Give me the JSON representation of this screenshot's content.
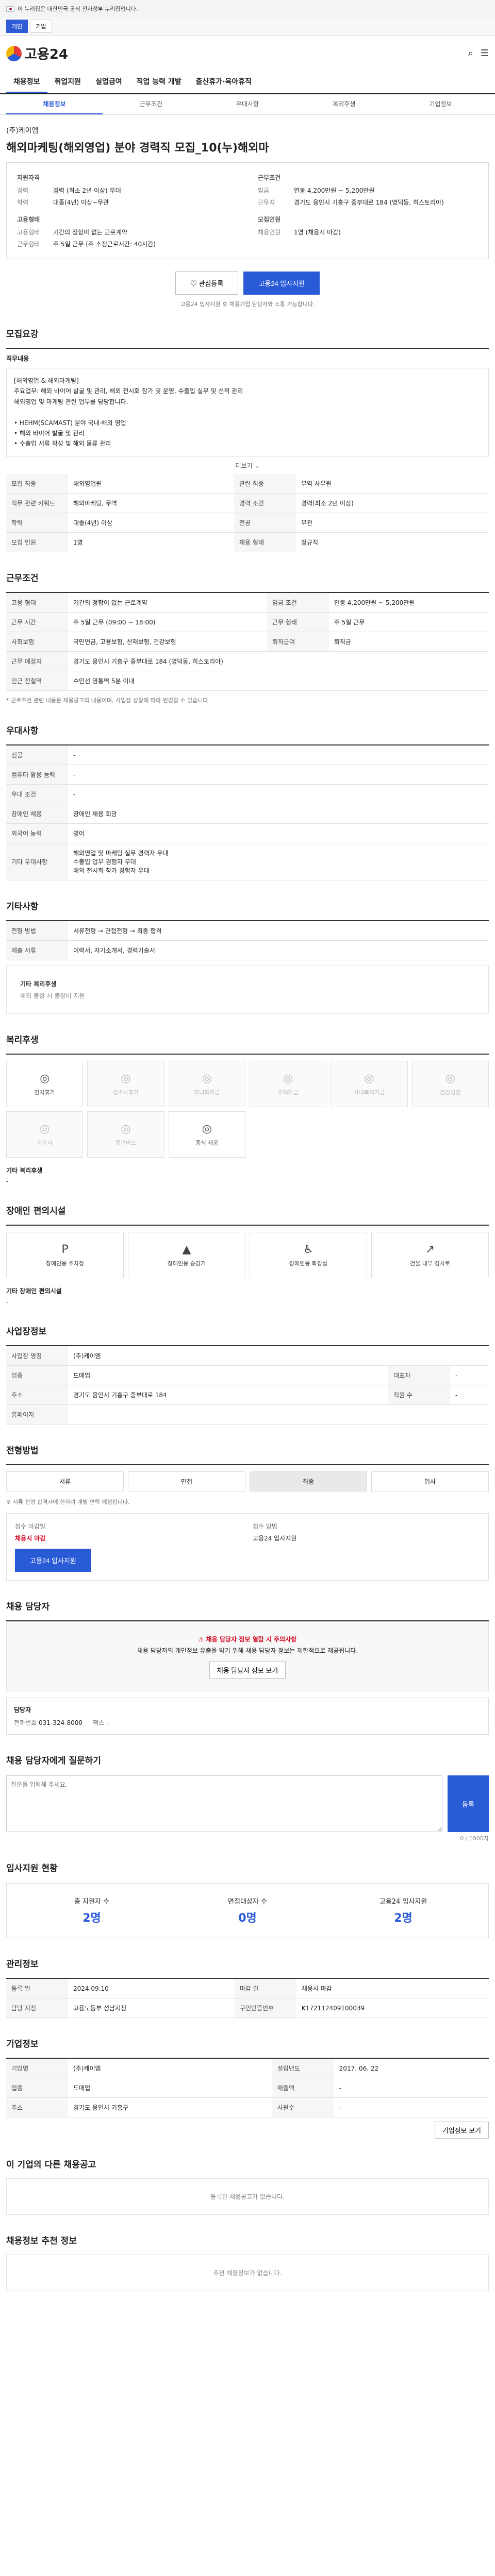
{
  "gov_notice": "이 누리집은 대한민국 공식 전자정부 누리집입니다.",
  "top_tabs": [
    "개인",
    "기업"
  ],
  "logo": "고용24",
  "nav": [
    "채용정보",
    "취업지원",
    "실업급여",
    "직업 능력 개발",
    "출산휴가·육아휴직"
  ],
  "subnav": [
    "채용정보",
    "근무조건",
    "우대사항",
    "복리후생",
    "기업정보"
  ],
  "company": "(주)케이엠",
  "title": "해외마케팅(해외영업) 분야 경력직 모집_10(누)해외마",
  "summary": {
    "left_label": "지원자격",
    "left": [
      {
        "k": "경력",
        "v": "경력 (최소 2년 이상) 우대"
      },
      {
        "k": "학력",
        "v": "대졸(4년) 이상~무관"
      }
    ],
    "left2_label": "고용형태",
    "left2": [
      {
        "k": "고용형태",
        "v": "기간의 정함이 없는 근로계약"
      },
      {
        "k": "근무형태",
        "v": "주 5일 근무 (주 소정근로시간: 40시간)"
      }
    ],
    "right_label": "근무조건",
    "right": [
      {
        "k": "임금",
        "v": "연봉 4,200만원 ~ 5,200만원"
      },
      {
        "k": "근무지",
        "v": "경기도 용인시 기흥구 중부대로 184 (영덕동, 히스토리아)"
      }
    ],
    "right2_label": "모집인원",
    "right2": [
      {
        "k": "채용인원",
        "v": "1명 (채용시 마감)"
      }
    ]
  },
  "buttons": {
    "scrap": "관심등록",
    "apply": "고용24 입사지원"
  },
  "notice": "고용24 입사지원 후 채용기업 담당자와 소통 가능합니다.",
  "recruit": {
    "section": "모집요강",
    "desc_title": "직무내용",
    "desc": "[해외영업 & 해외마케팅]\n주요업무: 해외 바이어 발굴 및 관리, 해외 전시회 참가 및 운영, 수출입 실무 및 선적 관리\n해외영업 및 마케팅 관련 업무를 담당합니다.\n\n• HEHM(SCAMAST) 분야 국내·해외 영업\n• 해외 바이어 발굴 및 관리\n• 수출입 서류 작성 및 해외 물류 관리",
    "more": "더보기",
    "rows": [
      {
        "k": "모집 직종",
        "v": "해외영업원",
        "k2": "관련 직종",
        "v2": "무역 사무원"
      },
      {
        "k": "직무 관련 키워드",
        "v": "해외마케팅, 무역",
        "k2": "경력 조건",
        "v2": "경력(최소 2년 이상)"
      },
      {
        "k": "학력",
        "v": "대졸(4년) 이상",
        "k2": "전공",
        "v2": "무관"
      },
      {
        "k": "모집 인원",
        "v": "1명",
        "k2": "채용 형태",
        "v2": "정규직"
      }
    ]
  },
  "conditions": {
    "section": "근무조건",
    "rows": [
      {
        "k": "고용 형태",
        "v": "기간의 정함이 없는 근로계약",
        "k2": "임금 조건",
        "v2": "연봉 4,200만원 ~ 5,200만원"
      },
      {
        "k": "근무 시간",
        "v": "주 5일 근무 (09:00 ~ 18:00)",
        "k2": "근무 형태",
        "v2": "주 5일 근무"
      },
      {
        "k": "사회보험",
        "v": "국민연금, 고용보험, 산재보험, 건강보험",
        "k2": "퇴직급여",
        "v2": "퇴직금"
      },
      {
        "k": "근무 예정지",
        "v": "경기도 용인시 기흥구 중부대로 184 (영덕동, 히스토리아)",
        "k2": "",
        "v2": ""
      },
      {
        "k": "인근 전철역",
        "v": "수인선 영통역 5분 이내",
        "k2": "",
        "v2": ""
      }
    ],
    "note": "* 근로조건 관련 내용은 채용공고의 내용이며, 사업장 상황에 따라 변경될 수 있습니다."
  },
  "prefer": {
    "section": "우대사항",
    "rows": [
      {
        "k": "전공",
        "v": "-"
      },
      {
        "k": "컴퓨터 활용 능력",
        "v": "-"
      },
      {
        "k": "우대 조건",
        "v": "-"
      },
      {
        "k": "장애인 채용",
        "v": "장애인 채용 희망"
      },
      {
        "k": "외국어 능력",
        "v": "영어"
      },
      {
        "k": "기타 우대사항",
        "v": "해외영업 및 마케팅 실무 경력자 우대\n수출입 업무 경험자 우대\n해외 전시회 참가 경험자 우대"
      }
    ]
  },
  "etc": {
    "section": "기타사항",
    "rows": [
      {
        "k": "전형 방법",
        "v": "서류전형 → 면접전형 → 최종 합격"
      },
      {
        "k": "제출 서류",
        "v": "이력서, 자기소개서, 경력기술서"
      }
    ],
    "sub_title": "기타 복리후생",
    "sub_val": "해외 출장 시 출장비 지원"
  },
  "welfare": {
    "section": "복리후생",
    "items": [
      {
        "label": "연차휴가",
        "icon": "◎",
        "on": true
      },
      {
        "label": "경조사휴가",
        "icon": "◎",
        "on": false
      },
      {
        "label": "자녀학자금",
        "icon": "◎",
        "on": false
      },
      {
        "label": "주택자금",
        "icon": "◎",
        "on": false
      },
      {
        "label": "사내복지기금",
        "icon": "◎",
        "on": false
      },
      {
        "label": "건강검진",
        "icon": "◎",
        "on": false
      },
      {
        "label": "기숙사",
        "icon": "◎",
        "on": false
      },
      {
        "label": "통근버스",
        "icon": "◎",
        "on": false
      },
      {
        "label": "중식 제공",
        "icon": "◎",
        "on": true
      }
    ],
    "etc_title": "기타 복리후생",
    "etc_val": "-"
  },
  "disabled": {
    "section": "장애인 편의시설",
    "items": [
      {
        "label": "장애인용 주차장",
        "icon": "P"
      },
      {
        "label": "장애인용 승강기",
        "icon": "▲"
      },
      {
        "label": "장애인용 화장실",
        "icon": "♿"
      },
      {
        "label": "건물 내부 경사로",
        "icon": "↗"
      }
    ],
    "etc_title": "기타 장애인 편의시설",
    "etc_val": "-"
  },
  "company_info": {
    "section": "사업장정보",
    "rows": [
      {
        "k": "사업장 명칭",
        "v": "(주)케이엠",
        "k2": "",
        "v2": ""
      },
      {
        "k": "업종",
        "v": "도매업",
        "k2": "대표자",
        "v2": "-"
      },
      {
        "k": "주소",
        "v": "경기도 용인시 기흥구 중부대로 184",
        "k2": "직원 수",
        "v2": "-"
      },
      {
        "k": "홈페이지",
        "v": "-",
        "k2": "",
        "v2": ""
      }
    ]
  },
  "process": {
    "section": "전형방법",
    "steps": [
      "서류",
      "면접",
      "최종",
      "입사"
    ],
    "note": "※ 서류 전형 합격자에 한하여 개별 연락 예정입니다.",
    "apply_title": "접수 방법",
    "apply_val": "고용24 입사지원",
    "deadline_title": "접수 마감일",
    "deadline_val": "채용시 마감",
    "apply_btn": "고용24 입사지원"
  },
  "contact": {
    "section": "채용 담당자",
    "alert1": "채용 담당자 정보 열람 시 주의사항",
    "alert2": "채용 담당자의 개인정보 유출을 막기 위해 채용 담당자 정보는 제한적으로 제공됩니다.",
    "alert3": "채용 담당자 정보 보기",
    "name_label": "담당자",
    "phone_label": "전화번호",
    "phone": "031-324-8000",
    "fax_label": "팩스",
    "fax": "-"
  },
  "inquiry": {
    "section": "채용 담당자에게 질문하기",
    "placeholder": "질문을 입력해 주세요.",
    "submit": "등록",
    "counter": "0 / 1000자"
  },
  "stats": {
    "section": "입사지원 현황",
    "items": [
      {
        "label": "총 지원자 수",
        "val": "2명"
      },
      {
        "label": "면접대상자 수",
        "val": "0명"
      },
      {
        "label": "고용24 입사지원",
        "val": "2명"
      }
    ]
  },
  "meta": {
    "section": "관리정보",
    "rows": [
      {
        "k": "등록 일",
        "v": "2024.09.10",
        "k2": "마감 일",
        "v2": "채용시 마감"
      },
      {
        "k": "담당 지청",
        "v": "고용노동부 성남지청",
        "k2": "구인인증번호",
        "v2": "K172112409100039"
      }
    ]
  },
  "company_card": {
    "section": "기업정보",
    "rows": [
      {
        "k": "기업명",
        "v": "(주)케이엠",
        "k2": "설립년도",
        "v2": "2017. 06. 22"
      },
      {
        "k": "업종",
        "v": "도매업",
        "k2": "매출액",
        "v2": "-"
      },
      {
        "k": "주소",
        "v": "경기도 용인시 기흥구",
        "k2": "사원수",
        "v2": "-"
      }
    ],
    "btn": "기업정보 보기"
  },
  "same_company": {
    "section": "이 기업의 다른 채용공고",
    "empty": "등록된 채용공고가 없습니다."
  },
  "recommend": {
    "section": "채용정보 추천 정보",
    "empty": "추천 채용정보가 없습니다."
  }
}
